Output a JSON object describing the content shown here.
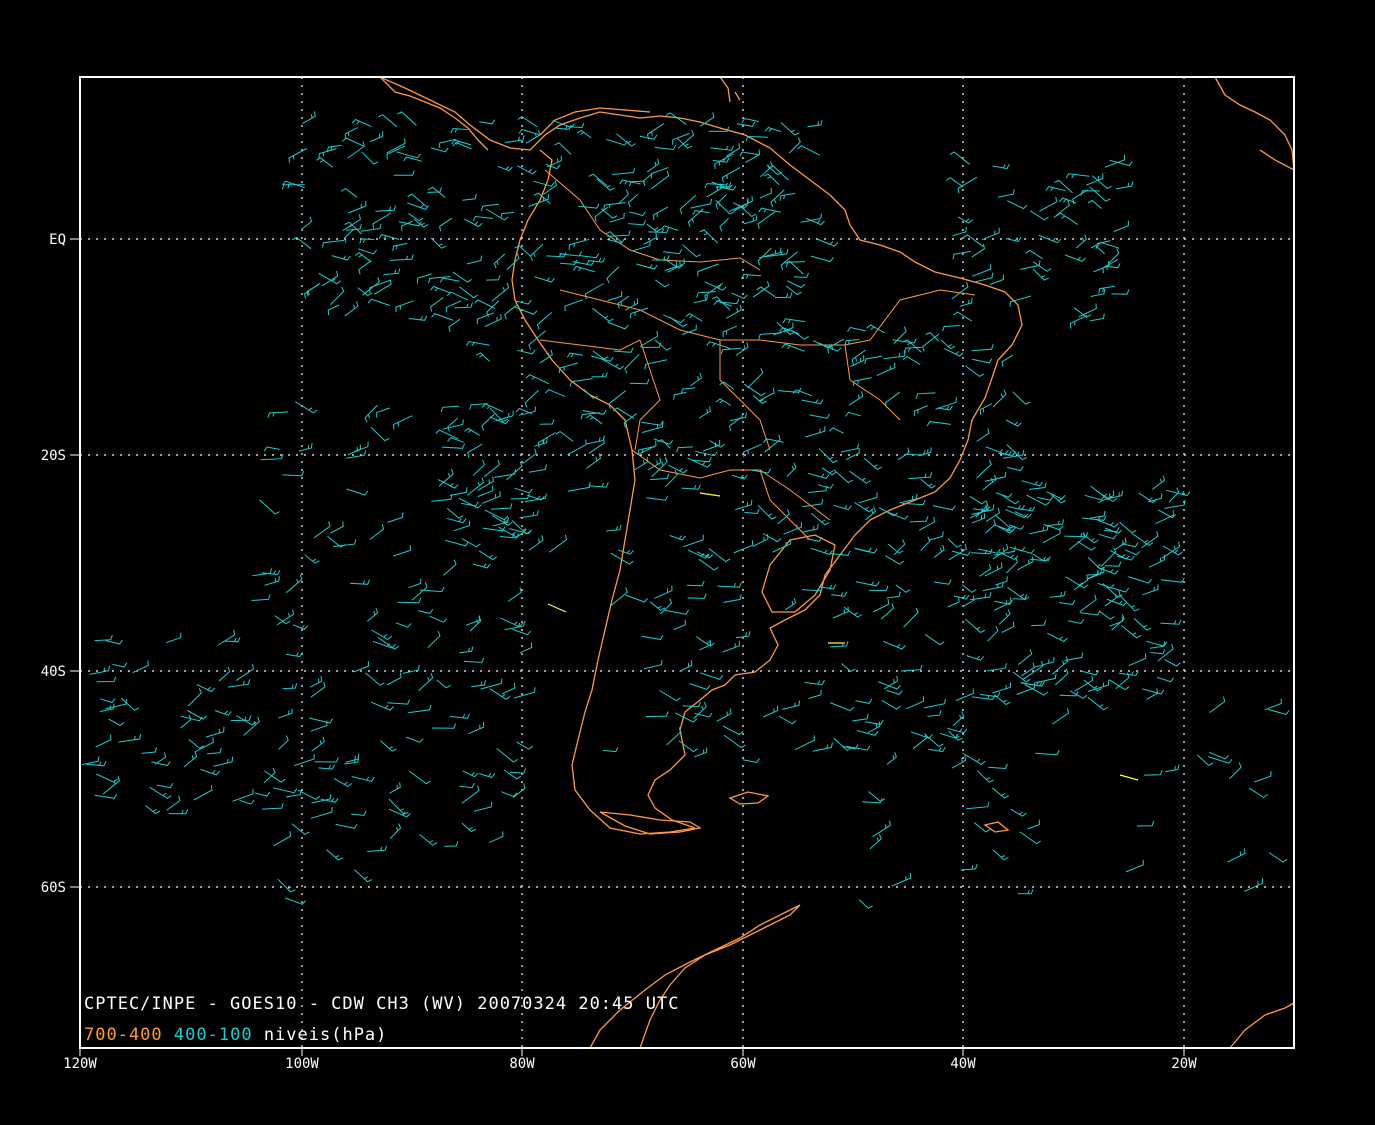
{
  "plot": {
    "caption": "CPTEC/INPE - GOES10 - CDW CH3 (WV) 20070324 20:45 UTC",
    "legend": [
      {
        "label": "700-400",
        "color": "#ff9933"
      },
      {
        "label": "400-100",
        "color": "#22cccc"
      },
      {
        "label": "niveis(hPa)",
        "color": "#ffffff"
      }
    ]
  },
  "axes": {
    "lon_ticks": [
      "120W",
      "100W",
      "80W",
      "60W",
      "40W",
      "20W"
    ],
    "lat_ticks": [
      "EQ",
      "20S",
      "40S",
      "60S"
    ],
    "lon_range": [
      -120,
      -9
    ],
    "lat_range": [
      -75,
      15
    ],
    "grid": true
  },
  "colors": {
    "coastline": "#ff9944",
    "wind_upper": "#22cccc",
    "wind_low": "#ffff33",
    "frame": "#ffffff",
    "grid": "#ffffff",
    "background": "#000000"
  }
}
